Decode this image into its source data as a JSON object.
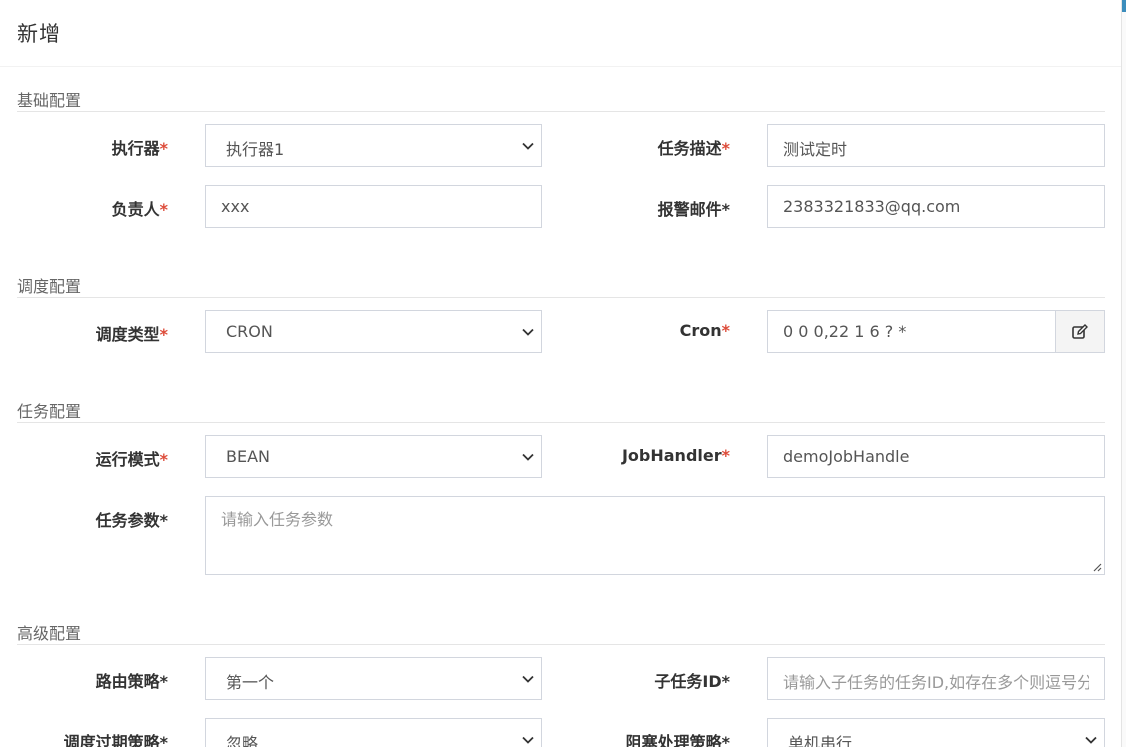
{
  "dialog": {
    "title": "新增"
  },
  "sections": {
    "basic": "基础配置",
    "schedule": "调度配置",
    "task": "任务配置",
    "advanced": "高级配置"
  },
  "fields": {
    "executor": {
      "label": "执行器",
      "value": "执行器1",
      "required_mark": "*"
    },
    "job_desc": {
      "label": "任务描述",
      "value": "测试定时",
      "required_mark": "*"
    },
    "author": {
      "label": "负责人",
      "value": "xxx",
      "required_mark": "*"
    },
    "alarm_email": {
      "label": "报警邮件*",
      "value": "2383321833@qq.com"
    },
    "schedule_type": {
      "label": "调度类型",
      "value": "CRON",
      "required_mark": "*"
    },
    "cron": {
      "label": "Cron",
      "value": "0 0 0,22 1 6 ? *",
      "required_mark": "*",
      "edit_icon": "edit-icon"
    },
    "run_mode": {
      "label": "运行模式",
      "value": "BEAN",
      "required_mark": "*"
    },
    "job_handler": {
      "label": "JobHandler",
      "value": "demoJobHandle",
      "required_mark": "*"
    },
    "job_param": {
      "label": "任务参数*",
      "value": "",
      "placeholder": "请输入任务参数"
    },
    "route_strategy": {
      "label": "路由策略*",
      "value": "第一个"
    },
    "child_job_id": {
      "label": "子任务ID*",
      "value": "",
      "placeholder": "请输入子任务的任务ID,如存在多个则逗号分隔"
    },
    "misfire_strategy": {
      "label": "调度过期策略*",
      "value": "忽略"
    },
    "block_strategy": {
      "label": "阻塞处理策略*",
      "value": "单机串行"
    }
  },
  "colors": {
    "required": "#dd4b39",
    "border": "#d2d6de",
    "addon_bg": "#f4f4f4",
    "accent": "#3c8dbc"
  }
}
